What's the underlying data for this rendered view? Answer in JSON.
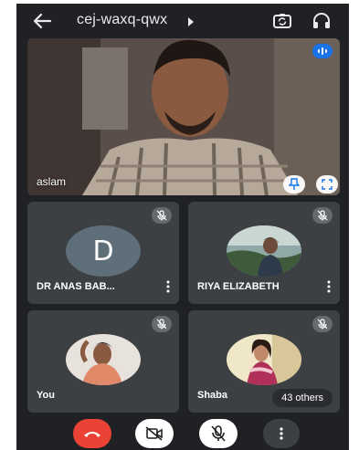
{
  "header": {
    "meeting_code": "cej-waxq-qwx",
    "icons": [
      "back-arrow-icon",
      "caret-right-icon",
      "switch-camera-icon",
      "headphones-icon"
    ]
  },
  "main_speaker": {
    "name": "aslam",
    "icons": [
      "speaking-indicator-icon",
      "pin-icon",
      "fullscreen-icon"
    ]
  },
  "participants": [
    {
      "name": "DR ANAS BAB...",
      "avatar_letter": "D",
      "avatar_color": "#5f6f79",
      "muted": true
    },
    {
      "name": "RIYA ELIZABETH",
      "avatar": "photo",
      "muted": true
    },
    {
      "name": "You",
      "avatar": "photo",
      "muted": true
    },
    {
      "name": "Shaba",
      "avatar": "photo",
      "muted": true,
      "others_label": "43 others"
    }
  ],
  "controls": {
    "icons": [
      "end-call-icon",
      "camera-off-icon",
      "mic-off-icon",
      "more-vertical-icon"
    ]
  },
  "colors": {
    "background": "#202124",
    "tile": "#3c4043",
    "end_call": "#ea4335",
    "accent": "#1a73e8"
  }
}
